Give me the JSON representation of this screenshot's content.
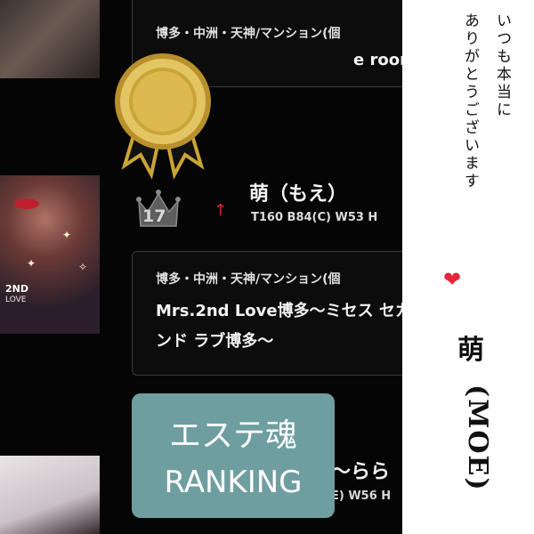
{
  "shops": [
    {
      "area": "博多・中洲・天神/マンション(個",
      "name": "e room"
    },
    {
      "area": "博多・中洲・天神/マンション(個",
      "name": "Mrs.2nd Love博多〜ミセス セカンド ラブ博多〜"
    }
  ],
  "ranking": {
    "rank": "17",
    "trend": "↑",
    "name": "萌（もえ）",
    "spec": "T160 B84(C) W53 H"
  },
  "next_entry": {
    "name_fragment": "〜らら",
    "spec_fragment": "E) W56 H"
  },
  "thumb_badge": {
    "line1": "2ND",
    "line2": "LOVE"
  },
  "banner": {
    "line1": "エステ魂",
    "line2": "RANKING"
  },
  "message": {
    "col1": "いつも本当に",
    "col2": "ありがとうございます",
    "heart": "❤"
  },
  "signature": {
    "name": "萌",
    "romanized": "(MOE)"
  },
  "colors": {
    "banner": "#6f9ea0",
    "arrow": "#e0202c",
    "heart": "#e5253a",
    "medal": "#c9a437"
  },
  "icons": [
    "gold-medal-icon",
    "crown-icon",
    "up-arrow-icon",
    "heart-icon"
  ]
}
